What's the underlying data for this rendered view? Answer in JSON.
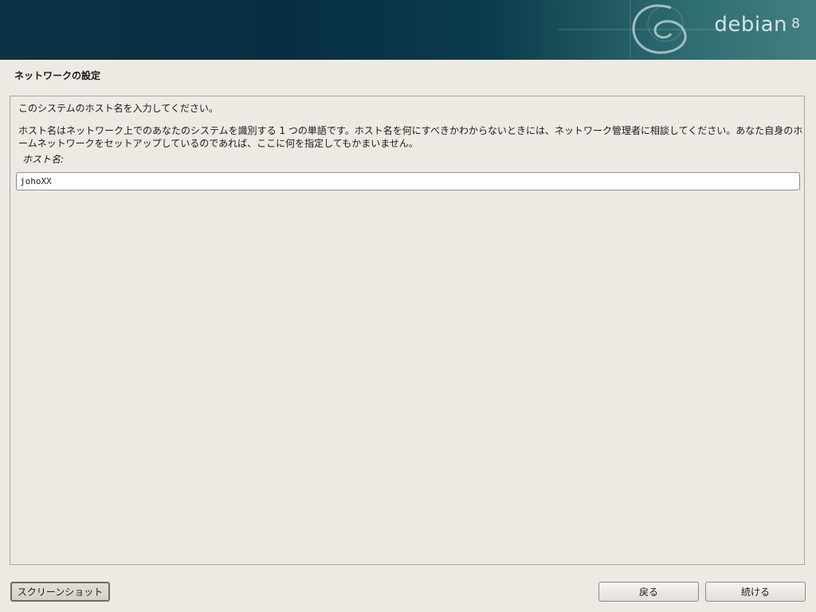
{
  "banner": {
    "title": "debian",
    "version": "8"
  },
  "step_title": "ネットワークの設定",
  "form": {
    "prompt": "このシステムのホスト名を入力してください。",
    "description": "ホスト名はネットワーク上でのあなたのシステムを識別する 1 つの単語です。ホスト名を何にすべきかわからないときには、ネットワーク管理者に相談してください。あなた自身のホームネットワークをセットアップしているのであれば、ここに何を指定してもかまいません。",
    "hostname_label": "ホスト名:",
    "hostname_value": "johoXX"
  },
  "buttons": {
    "screenshot": "スクリーンショット",
    "back": "戻る",
    "continue": "続ける"
  },
  "icons": {
    "logo": "debian-swirl-icon"
  }
}
